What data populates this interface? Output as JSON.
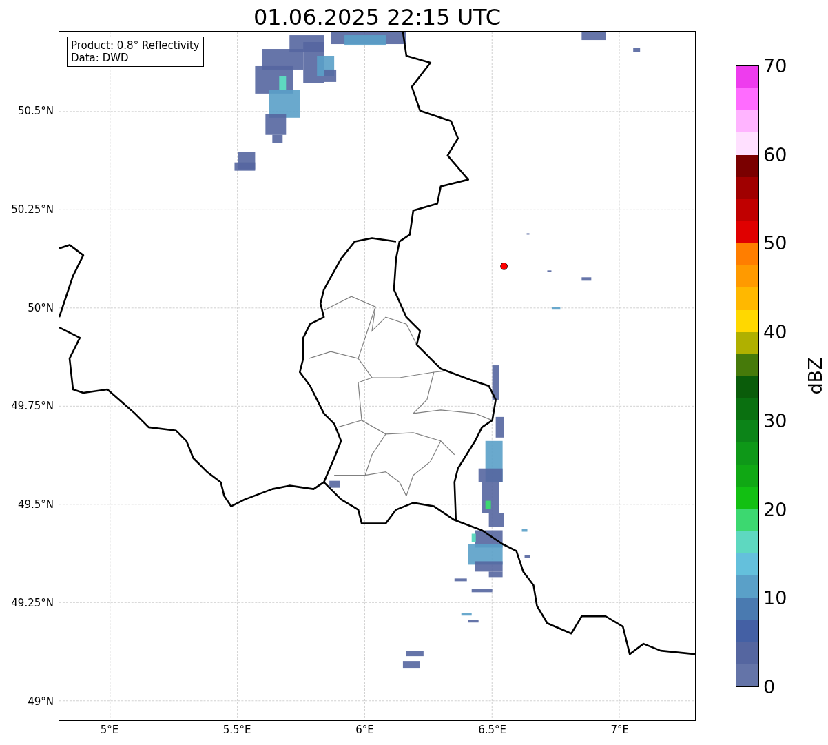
{
  "title": "01.06.2025 22:15 UTC",
  "info_box": [
    "Product: 0.8° Reflectivity",
    "Data: DWD"
  ],
  "y_axis": {
    "ticks": [
      "50.5°N",
      "50.25°N",
      "50°N",
      "49.75°N",
      "49.5°N",
      "49.25°N",
      "49°N"
    ]
  },
  "x_axis": {
    "ticks": [
      "5°E",
      "5.5°E",
      "6°E",
      "6.5°E",
      "7°E"
    ]
  },
  "colorbar": {
    "label": "dBZ",
    "ticks": [
      "70",
      "60",
      "50",
      "40",
      "30",
      "20",
      "10",
      "0"
    ],
    "bands": [
      {
        "color": "#ee3cee"
      },
      {
        "color": "#ff6cff"
      },
      {
        "color": "#ffb4ff"
      },
      {
        "color": "#ffe0ff"
      },
      {
        "color": "#7a0000"
      },
      {
        "color": "#a00000"
      },
      {
        "color": "#c00000"
      },
      {
        "color": "#e00000"
      },
      {
        "color": "#ff7e00"
      },
      {
        "color": "#ff9a00"
      },
      {
        "color": "#ffb800"
      },
      {
        "color": "#ffd800"
      },
      {
        "color": "#b0b000"
      },
      {
        "color": "#467a0a"
      },
      {
        "color": "#0a5c0a"
      },
      {
        "color": "#0a7010"
      },
      {
        "color": "#0c8418"
      },
      {
        "color": "#0e9818"
      },
      {
        "color": "#10a814"
      },
      {
        "color": "#12c012"
      },
      {
        "color": "#3cd870"
      },
      {
        "color": "#5ed8c0"
      },
      {
        "color": "#64c0dc"
      },
      {
        "color": "#5aa0c8"
      },
      {
        "color": "#4a7ab0"
      },
      {
        "color": "#4460a4"
      },
      {
        "color": "#5566a0"
      },
      {
        "color": "#6474a8"
      }
    ]
  }
}
